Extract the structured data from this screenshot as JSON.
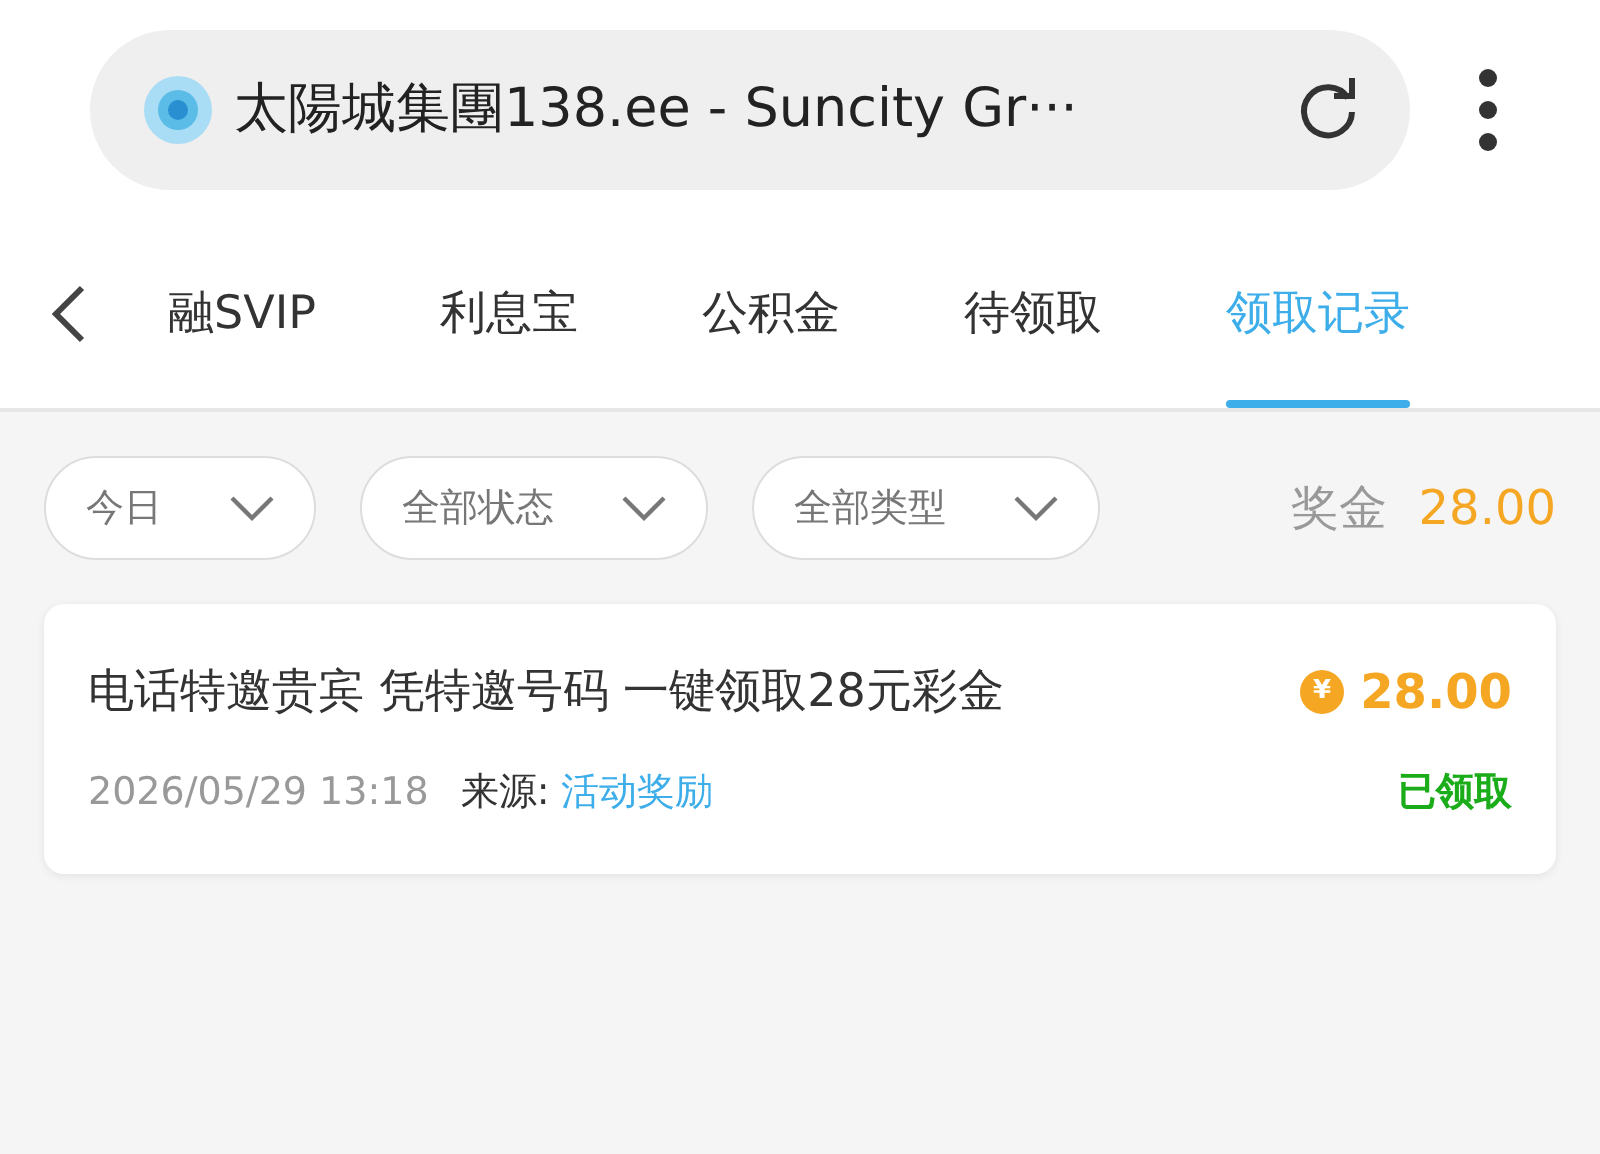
{
  "browser": {
    "title": "太陽城集團138.ee - Suncity Gr···"
  },
  "tabs": [
    {
      "label": "融SVIP",
      "selected": false
    },
    {
      "label": "利息宝",
      "selected": false
    },
    {
      "label": "公积金",
      "selected": false
    },
    {
      "label": "待领取",
      "selected": false
    },
    {
      "label": "领取记录",
      "selected": true
    }
  ],
  "filters": [
    {
      "label": "今日"
    },
    {
      "label": "全部状态"
    },
    {
      "label": "全部类型"
    }
  ],
  "bonus_total": {
    "label": "奖金",
    "amount": "28.00"
  },
  "records": [
    {
      "title": "电话特邀贵宾 凭特邀号码 一键领取28元彩金",
      "coin": "¥",
      "amount": "28.00",
      "time": "2026/05/29 13:18",
      "source_label": "来源:",
      "source": "活动奖励",
      "status": "已领取"
    }
  ]
}
